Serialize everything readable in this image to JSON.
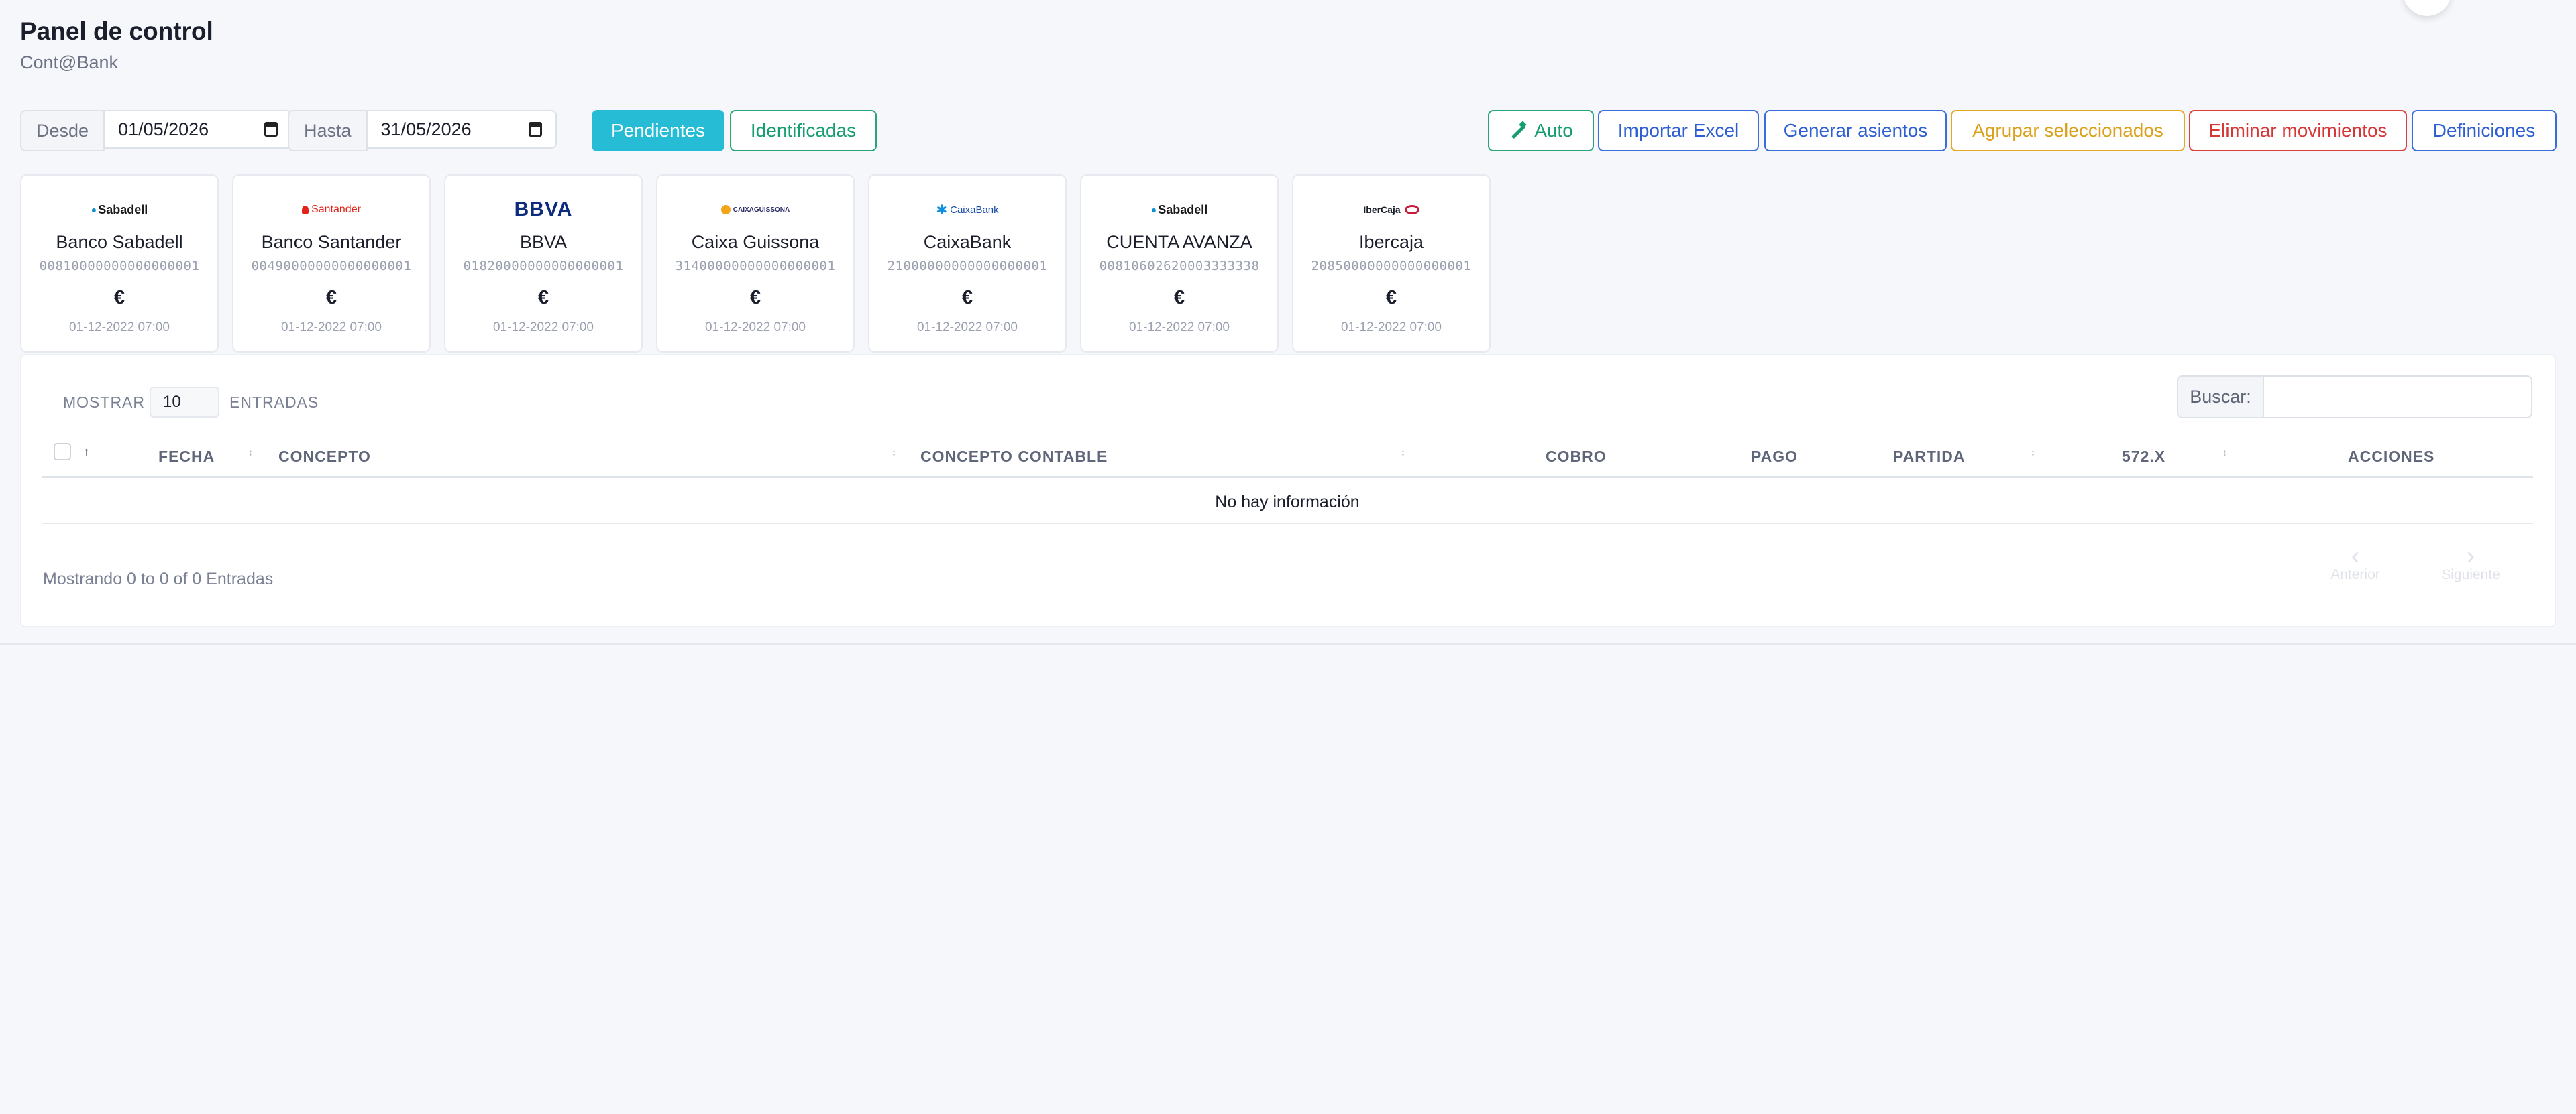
{
  "header": {
    "title": "Panel de control",
    "subtitle": "Cont@Bank"
  },
  "filters": {
    "desde_label": "Desde",
    "desde_value": "01/05/2026",
    "hasta_label": "Hasta",
    "hasta_value": "31/05/2026"
  },
  "tabs": {
    "pendientes": "Pendientes",
    "identificadas": "Identificadas"
  },
  "actions": {
    "auto": "Auto",
    "importar": "Importar Excel",
    "generar": "Generar asientos",
    "agrupar": "Agrupar seleccionados",
    "eliminar": "Eliminar movimientos",
    "definiciones": "Definiciones"
  },
  "banks": [
    {
      "logo": "Sabadell",
      "name": "Banco Sabadell",
      "number": "00810000000000000001",
      "currency": "€",
      "date": "01-12-2022 07:00"
    },
    {
      "logo": "Santander",
      "name": "Banco Santander",
      "number": "00490000000000000001",
      "currency": "€",
      "date": "01-12-2022 07:00"
    },
    {
      "logo": "BBVA",
      "name": "BBVA",
      "number": "01820000000000000001",
      "currency": "€",
      "date": "01-12-2022 07:00"
    },
    {
      "logo": "CAIXAGUISSONA",
      "name": "Caixa Guissona",
      "number": "31400000000000000001",
      "currency": "€",
      "date": "01-12-2022 07:00"
    },
    {
      "logo": "CaixaBank",
      "name": "CaixaBank",
      "number": "21000000000000000001",
      "currency": "€",
      "date": "01-12-2022 07:00"
    },
    {
      "logo": "Sabadell",
      "name": "CUENTA AVANZA",
      "number": "00810602620003333338",
      "currency": "€",
      "date": "01-12-2022 07:00"
    },
    {
      "logo": "IberCaja",
      "name": "Ibercaja",
      "number": "20850000000000000001",
      "currency": "€",
      "date": "01-12-2022 07:00"
    }
  ],
  "table": {
    "show_label": "MOSTRAR",
    "show_value": "10",
    "entries_label": "ENTRADAS",
    "search_label": "Buscar:",
    "search_value": "",
    "sort_arrow": "↑",
    "columns": [
      "FECHA",
      "CONCEPTO",
      "CONCEPTO CONTABLE",
      "COBRO",
      "PAGO",
      "PARTIDA",
      "572.X",
      "ACCIONES"
    ],
    "empty_text": "No hay información",
    "info_text": "Mostrando 0 to 0 of 0 Entradas",
    "prev_label": "Anterior",
    "next_label": "Siguiente"
  }
}
